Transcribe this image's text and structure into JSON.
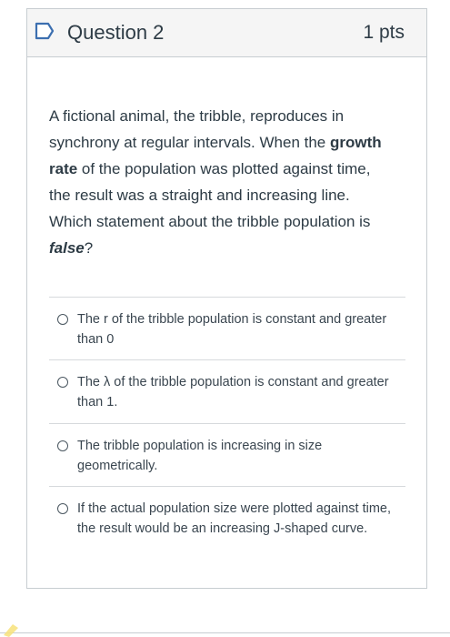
{
  "question": {
    "title": "Question 2",
    "points": "1 pts",
    "text_parts": [
      "A fictional animal, the tribble, reproduces in synchrony at regular intervals. When the ",
      "growth rate",
      " of the population was plotted against time, the result was a straight and increasing line. Which statement about the tribble population is ",
      "false",
      "?"
    ]
  },
  "answers": [
    {
      "label": "The r of the tribble population is constant and greater than 0"
    },
    {
      "label": "The λ of the tribble population is constant and greater than 1."
    },
    {
      "label": "The tribble population is increasing in size geometrically."
    },
    {
      "label": "If the actual population size were plotted against time, the result would be an increasing J-shaped curve."
    }
  ],
  "colors": {
    "header_bg": "#f5f5f5",
    "border": "#c7cdd1",
    "text": "#2d3b45",
    "flag_outline": "#3c6fb0"
  },
  "icons": {
    "flag": "bookmark-flag-icon",
    "radio": "radio-empty-icon"
  }
}
